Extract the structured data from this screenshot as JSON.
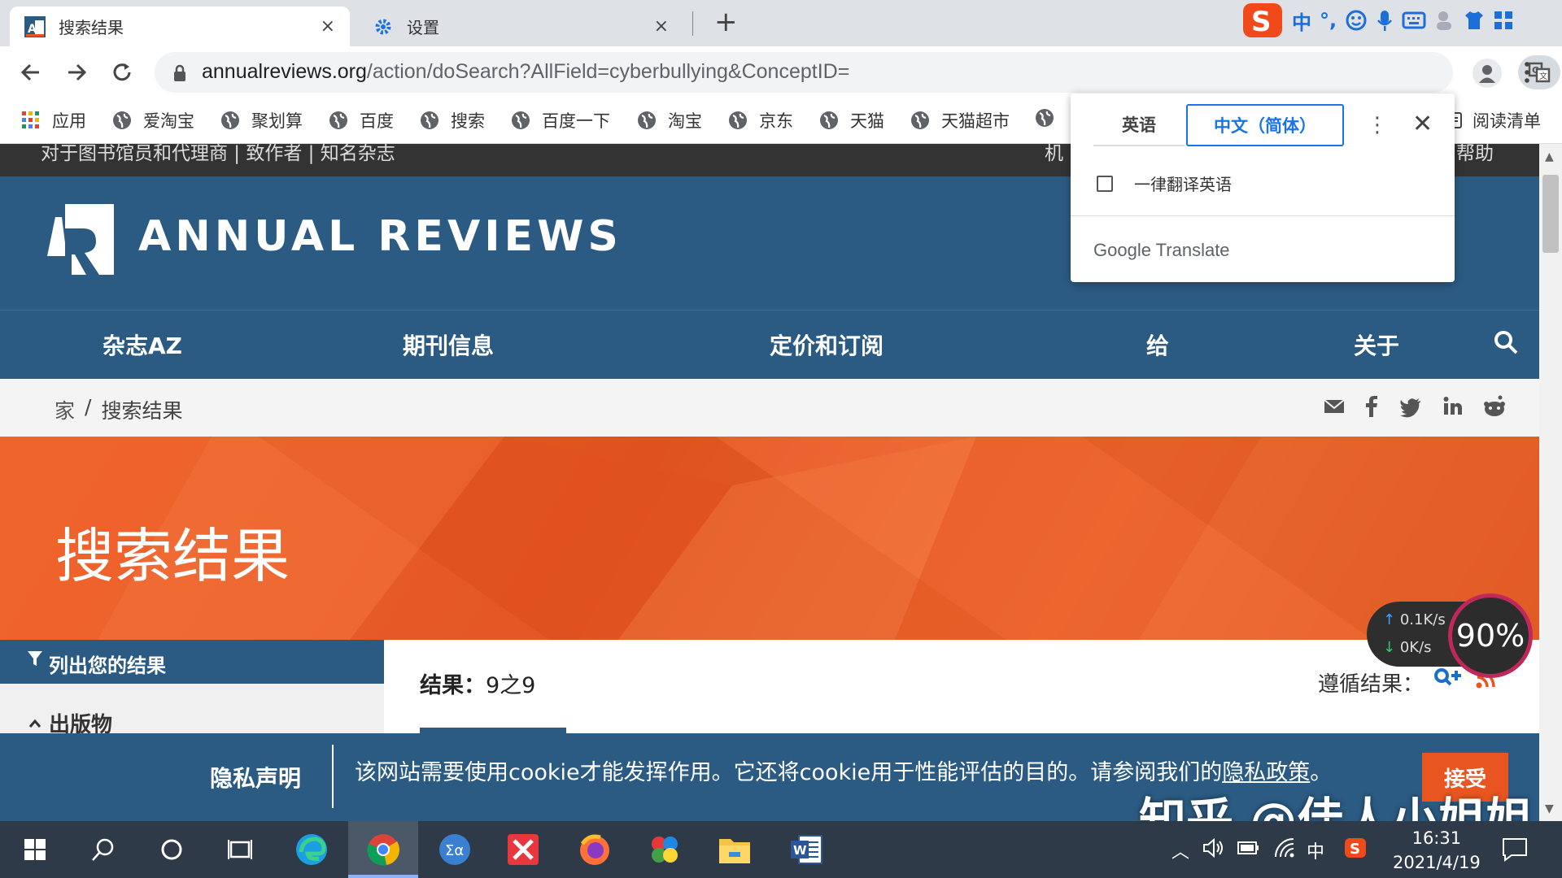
{
  "tabs": [
    {
      "title": "搜索结果",
      "close": "×"
    },
    {
      "title": "设置",
      "close": "×"
    }
  ],
  "new_tab": "+",
  "ime": {
    "lang": "中",
    "punct": "°,"
  },
  "address": {
    "host": "annualreviews.org",
    "path": "/action/doSearch?AllField=cyberbullying&ConceptID="
  },
  "bookmarks": [
    "应用",
    "爱淘宝",
    "聚划算",
    "百度",
    "搜索",
    "百度一下",
    "淘宝",
    "京东",
    "天猫",
    "天猫超市"
  ],
  "reading_list": "阅读清单",
  "translate_popup": {
    "source_lang": "英语",
    "target_lang": "中文（简体）",
    "always_translate": "一律翻译英语",
    "brand": "Google Translate"
  },
  "site": {
    "top_strip_left": "对于图书馆员和代理商 | 致作者 | 知名杂志",
    "top_strip_right1": "机",
    "top_strip_right2": "帮助",
    "logo_text": "ANNUAL  REVIEWS",
    "nav": [
      "杂志AZ",
      "期刊信息",
      "定价和订阅",
      "给",
      "关于"
    ],
    "breadcrumb": {
      "home": "家",
      "sep": "/",
      "current": "搜索结果"
    },
    "hero_title": "搜索结果",
    "sidebar": {
      "heading": "列出您的结果",
      "section": "出版物"
    },
    "results": {
      "label": "结果：",
      "count": "9之9",
      "follow": "遵循结果："
    },
    "privacy": {
      "heading": "隐私声明",
      "message": "该网站需要使用cookie才能发挥作用。它还将cookie用于性能评估的目的。请参阅我们的",
      "link": "隐私政策",
      "end": "。",
      "accept": "接受"
    }
  },
  "network_widget": {
    "up": "0.1K/s",
    "down": "0K/s",
    "percent": "90%"
  },
  "watermark": "知乎 @佳人小姐姐",
  "taskbar": {
    "ime": "中",
    "time": "16:31",
    "date": "2021/4/19"
  },
  "colors": {
    "header": "#2b5a82",
    "hero": "#e85520",
    "accent": "#1a73e8"
  }
}
